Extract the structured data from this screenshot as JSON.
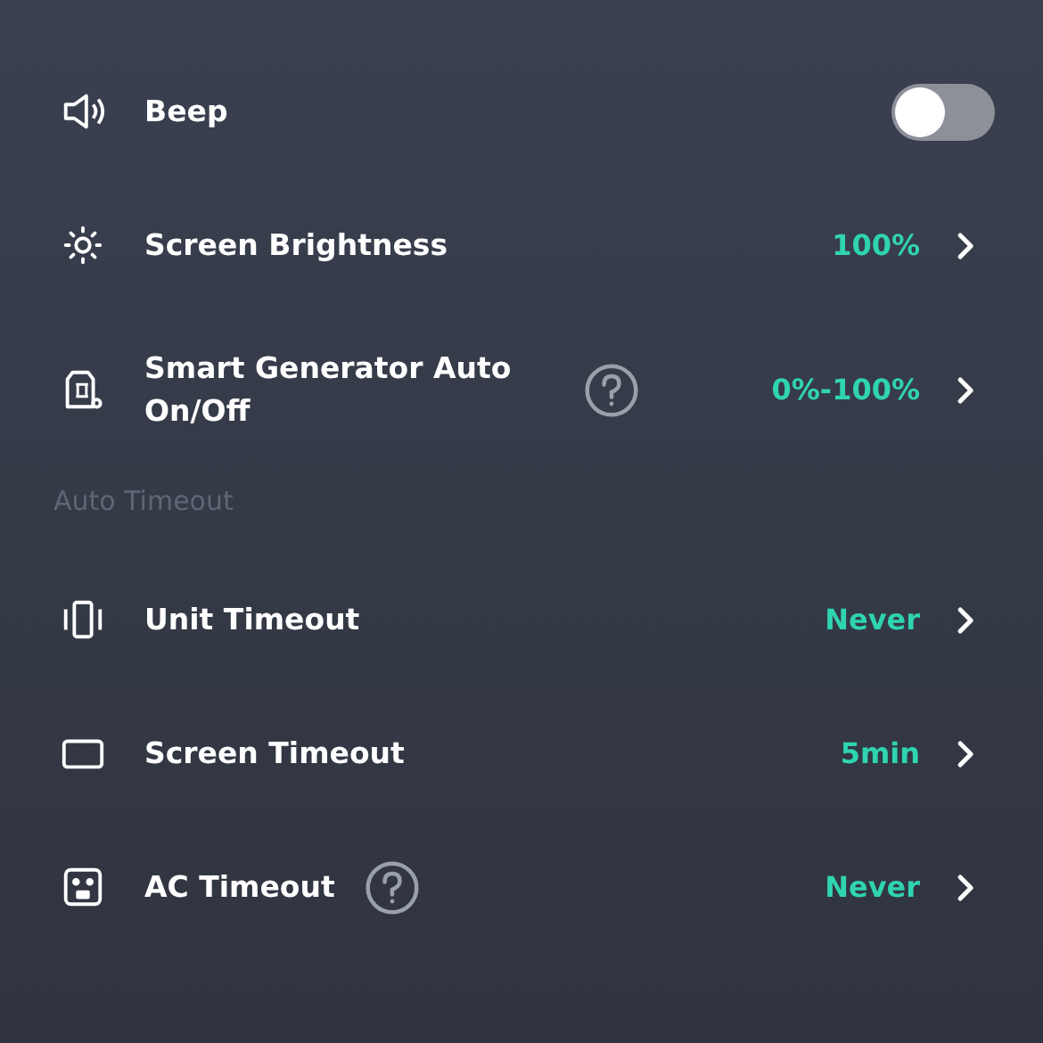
{
  "sections": [
    {
      "items": [
        {
          "kind": "toggle",
          "label": "Beep",
          "on": false
        },
        {
          "kind": "link",
          "label": "Screen Brightness",
          "value": "100%",
          "help": false
        },
        {
          "kind": "link",
          "label": "Smart Generator Auto On/Off",
          "value": "0%-100%",
          "help": true
        }
      ]
    },
    {
      "title": "Auto Timeout",
      "items": [
        {
          "kind": "link",
          "label": "Unit Timeout",
          "value": "Never",
          "help": false
        },
        {
          "kind": "link",
          "label": "Screen Timeout",
          "value": "5min",
          "help": false
        },
        {
          "kind": "link",
          "label": "AC Timeout",
          "value": "Never",
          "help": true
        }
      ]
    }
  ]
}
